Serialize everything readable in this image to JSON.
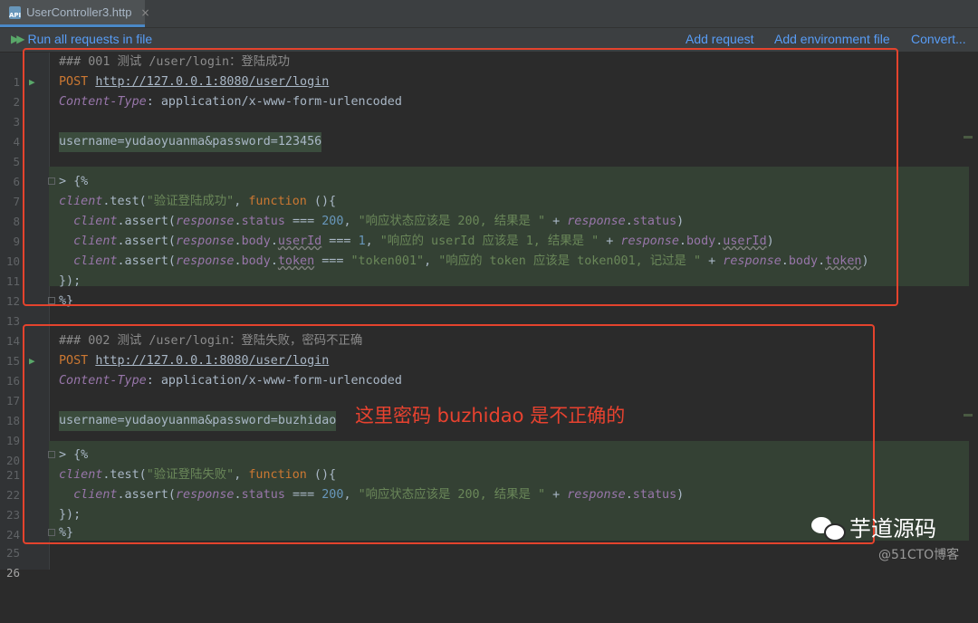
{
  "tab": {
    "icon": "API",
    "title": "UserController3.http",
    "close": "×"
  },
  "toolbar": {
    "run_all": "Run all requests in file",
    "add_request": "Add request",
    "add_env": "Add environment file",
    "convert": "Convert..."
  },
  "lines": {
    "l1": "### 001 测试 /user/login：登陆成功",
    "l2_method": "POST",
    "l2_url": "http://127.0.0.1:8080/user/login",
    "l3_header": "Content-Type",
    "l3_value": ": application/x-www-form-urlencoded",
    "l5": "username=yudaoyuanma&password=123456",
    "l7": "> {%",
    "l8_obj": "client",
    "l8_fn": ".test(",
    "l8_str": "\"验证登陆成功\"",
    "l8_kw": "function",
    "l8_rest": " (){",
    "l9_str": "\"响应状态应该是 200, 结果是 \"",
    "l10_str": "\"响应的 userId 应该是 1, 结果是 \"",
    "l11_str1": "\"token001\"",
    "l11_str2": "\"响应的 token 应该是 token001, 记过是 \"",
    "l12": "});",
    "l13": "%}",
    "l15": "### 002 测试 /user/login：登陆失败，密码不正确",
    "l19": "username=yudaoyuanma&password=buzhidao",
    "l22_str": "\"验证登陆失败\"",
    "l23_str": "\"响应状态应该是 200, 结果是 \""
  },
  "line_numbers": [
    "1",
    "2",
    "3",
    "4",
    "5",
    "6",
    "7",
    "8",
    "9",
    "10",
    "11",
    "12",
    "13",
    "14",
    "15",
    "16",
    "17",
    "18",
    "19",
    "20",
    "21",
    "22",
    "23",
    "24",
    "25",
    "26"
  ],
  "annotation": "这里密码 buzhidao 是不正确的",
  "watermark": {
    "brand": "芋道源码",
    "site": "@51CTO博客"
  },
  "colors": {
    "highlight_box": "#e4432d",
    "link": "#589df6",
    "run": "#59a869"
  }
}
